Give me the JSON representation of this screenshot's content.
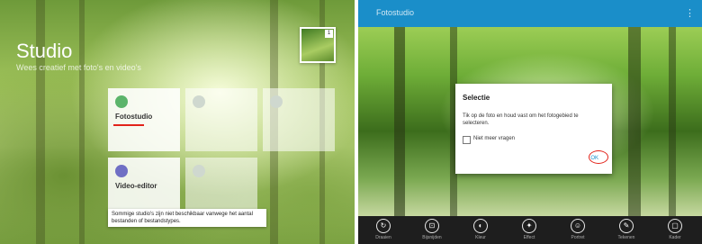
{
  "left": {
    "title": "Studio",
    "subtitle": "Wees creatief met foto's en video's",
    "tiles": [
      {
        "label": "Fotostudio",
        "icon": "photo-icon",
        "color": "#5bb46a"
      },
      {
        "label": "",
        "icon": "collage-icon",
        "color": "#cfd8cf"
      },
      {
        "label": "",
        "icon": "gif-icon",
        "color": "#cfd8cf"
      },
      {
        "label": "Video-editor",
        "icon": "video-icon",
        "color": "#6f6fc4"
      },
      {
        "label": "",
        "icon": "video-trim-icon",
        "color": "#cfd8cf"
      }
    ],
    "tooltip": "Sommige studio's zijn niet beschikbaar vanwege het aantal bestanden of bestandstypes.",
    "accent_red": "#e2231a"
  },
  "right": {
    "topbar": {
      "title": "Fotostudio",
      "menu": "⋮"
    },
    "dialog": {
      "title": "Selectie",
      "text": "Tik op de foto en houd vast om het fotogebied te selecteren.",
      "checkbox_label": "Niet meer vragen",
      "ok_label": "OK"
    },
    "tools": [
      {
        "label": "Draaien",
        "icon": "rotate-icon",
        "glyph": "↻"
      },
      {
        "label": "Bijsnijden",
        "icon": "crop-icon",
        "glyph": "⊡"
      },
      {
        "label": "Kleur",
        "icon": "color-icon",
        "glyph": "◐"
      },
      {
        "label": "Effect",
        "icon": "effect-icon",
        "glyph": "✦"
      },
      {
        "label": "Portret",
        "icon": "portrait-icon",
        "glyph": "☺"
      },
      {
        "label": "Tekenen",
        "icon": "draw-icon",
        "glyph": "✎"
      },
      {
        "label": "Kader",
        "icon": "frame-icon",
        "glyph": "▢"
      }
    ],
    "accent_blue": "#1a8ec9"
  }
}
